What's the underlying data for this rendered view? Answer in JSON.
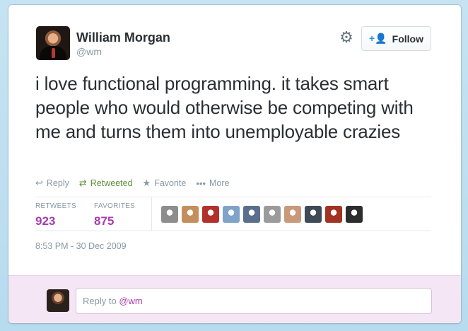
{
  "user": {
    "name": "William Morgan",
    "handle": "@wm"
  },
  "follow_label": "Follow",
  "tweet": {
    "text": "i love functional programming. it takes smart people who would otherwise be competing with me and turns them into unemployable crazies"
  },
  "actions": {
    "reply": "Reply",
    "retweeted": "Retweeted",
    "favorite": "Favorite",
    "more": "More"
  },
  "stats": {
    "retweets_label": "RETWEETS",
    "retweets": "923",
    "favorites_label": "FAVORITES",
    "favorites": "875"
  },
  "favoriters": [
    "#8d8d8d",
    "#c48f5a",
    "#b2312a",
    "#7fa3c9",
    "#5a6f8d",
    "#9b9b9b",
    "#c89a7a",
    "#3e4a55",
    "#a23222",
    "#2d2d2d"
  ],
  "timestamp": "8:53 PM - 30 Dec 2009",
  "reply": {
    "prefix": "Reply to ",
    "mention": "@wm"
  },
  "colors": {
    "accent": "#a53eab",
    "retweeted": "#5c913b",
    "follow_icon": "#2a96d6"
  }
}
